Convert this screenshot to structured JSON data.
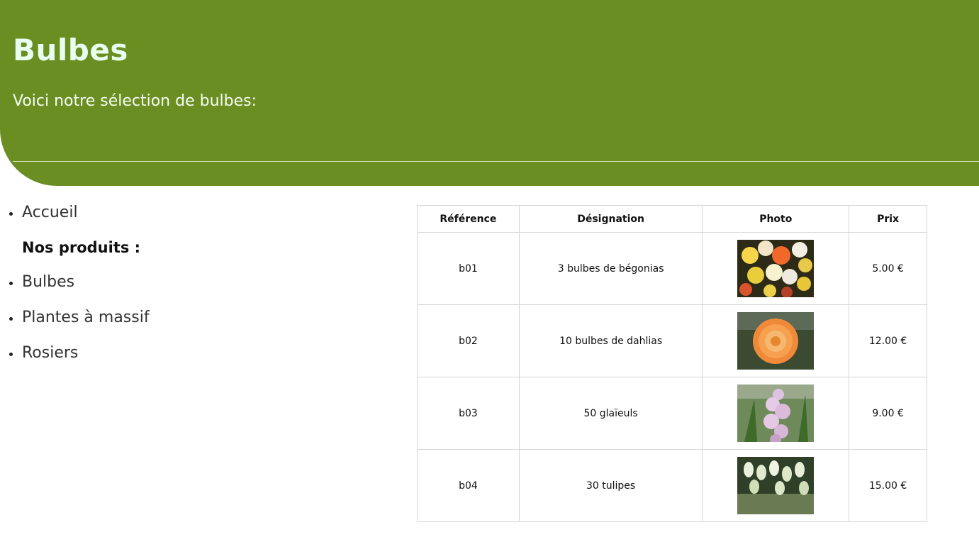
{
  "header": {
    "title": "Bulbes",
    "subtitle": "Voici notre sélection de bulbes:"
  },
  "nav": {
    "home": "Accueil",
    "products_heading": "Nos produits :",
    "items": [
      "Bulbes",
      "Plantes à massif",
      "Rosiers"
    ]
  },
  "table": {
    "headers": [
      "Référence",
      "Désignation",
      "Photo",
      "Prix"
    ],
    "rows": [
      {
        "ref": "b01",
        "name": "3 bulbes de bégonias",
        "photo": "begonia-photo",
        "price": "5.00 €"
      },
      {
        "ref": "b02",
        "name": "10 bulbes de dahlias",
        "photo": "dahlia-photo",
        "price": "12.00 €"
      },
      {
        "ref": "b03",
        "name": "50 glaïeuls",
        "photo": "gladiolus-photo",
        "price": "9.00 €"
      },
      {
        "ref": "b04",
        "name": "30 tulipes",
        "photo": "tulip-photo",
        "price": "15.00 €"
      }
    ]
  },
  "colors": {
    "header_bg": "#6b8e23",
    "title_color": "#eafff0"
  }
}
